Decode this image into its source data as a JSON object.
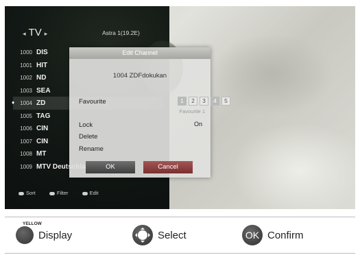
{
  "screen": {
    "header": {
      "mode": "TV",
      "satellite": "Astra 1(19.2E)"
    },
    "channels": [
      {
        "number": "1000",
        "name": "DIS"
      },
      {
        "number": "1001",
        "name": "HIT"
      },
      {
        "number": "1002",
        "name": "ND"
      },
      {
        "number": "1003",
        "name": "SEA"
      },
      {
        "number": "1004",
        "name": "ZD",
        "selected": true
      },
      {
        "number": "1005",
        "name": "TAG"
      },
      {
        "number": "1006",
        "name": "CIN"
      },
      {
        "number": "1007",
        "name": "CIN"
      },
      {
        "number": "1008",
        "name": "MT"
      },
      {
        "number": "1009",
        "name": "MTV Deutschland"
      }
    ],
    "legend": {
      "sort": "Sort",
      "filter": "Filter",
      "edit": "Edit"
    }
  },
  "dialog": {
    "title": "Edit Channel",
    "channel": "1004  ZDFdokukan",
    "favourite_label": "Favourite",
    "favourite_slots": [
      "1",
      "2",
      "3",
      "4",
      "5"
    ],
    "favourite_active": [
      1,
      4
    ],
    "favourite_sub": "Favourite 1",
    "lock_label": "Lock",
    "lock_value": "On",
    "delete_label": "Delete",
    "rename_label": "Rename",
    "ok_label": "OK",
    "cancel_label": "Cancel"
  },
  "bottom": {
    "yellow_key": "YELLOW",
    "display_label": "Display",
    "select_label": "Select",
    "ok_key": "OK",
    "confirm_label": "Confirm"
  }
}
